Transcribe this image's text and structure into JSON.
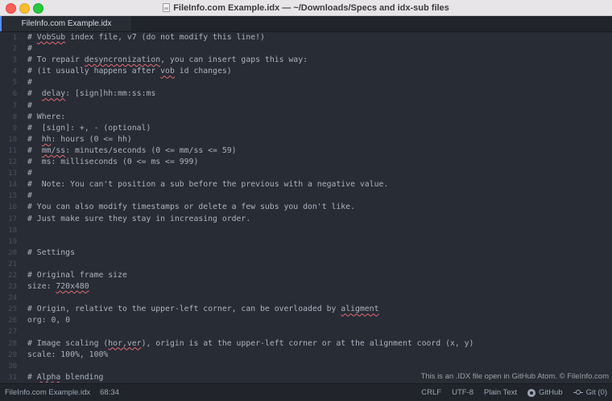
{
  "window": {
    "title": "FileInfo.com Example.idx — ~/Downloads/Specs and idx-sub files"
  },
  "tabs": [
    {
      "label": "FileInfo.com Example.idx",
      "active": true
    }
  ],
  "editor": {
    "lines": [
      {
        "n": "1",
        "text": "# VobSub index file, v7 (do not modify this line!)",
        "squiggles": [
          "VobSub"
        ]
      },
      {
        "n": "2",
        "text": "#"
      },
      {
        "n": "3",
        "text": "# To repair desyncronization, you can insert gaps this way:",
        "squiggles": [
          "desyncronization"
        ]
      },
      {
        "n": "4",
        "text": "# (it usually happens after vob id changes)",
        "squiggles": [
          "vob"
        ]
      },
      {
        "n": "5",
        "text": "#"
      },
      {
        "n": "6",
        "text": "#  delay: [sign]hh:mm:ss:ms",
        "squiggles": [
          "delay"
        ]
      },
      {
        "n": "7",
        "text": "#"
      },
      {
        "n": "8",
        "text": "# Where:"
      },
      {
        "n": "9",
        "text": "#  [sign]: +, - (optional)"
      },
      {
        "n": "10",
        "text": "#  hh: hours (0 <= hh)",
        "squiggles": [
          "hh"
        ]
      },
      {
        "n": "11",
        "text": "#  mm/ss: minutes/seconds (0 <= mm/ss <= 59)",
        "squiggles": [
          "mm/ss"
        ]
      },
      {
        "n": "12",
        "text": "#  ms: milliseconds (0 <= ms <= 999)"
      },
      {
        "n": "13",
        "text": "#"
      },
      {
        "n": "14",
        "text": "#  Note: You can't position a sub before the previous with a negative value."
      },
      {
        "n": "15",
        "text": "#"
      },
      {
        "n": "16",
        "text": "# You can also modify timestamps or delete a few subs you don't like."
      },
      {
        "n": "17",
        "text": "# Just make sure they stay in increasing order."
      },
      {
        "n": "18",
        "text": ""
      },
      {
        "n": "19",
        "text": ""
      },
      {
        "n": "20",
        "text": "# Settings"
      },
      {
        "n": "21",
        "text": ""
      },
      {
        "n": "22",
        "text": "# Original frame size"
      },
      {
        "n": "23",
        "text": "size: 720x480",
        "squiggles": [
          "720x480"
        ]
      },
      {
        "n": "24",
        "text": ""
      },
      {
        "n": "25",
        "text": "# Origin, relative to the upper-left corner, can be overloaded by aligment",
        "squiggles": [
          "aligment"
        ]
      },
      {
        "n": "26",
        "text": "org: 0, 0"
      },
      {
        "n": "27",
        "text": ""
      },
      {
        "n": "28",
        "text": "# Image scaling (hor,ver), origin is at the upper-left corner or at the alignment coord (x, y)",
        "squiggles": [
          "hor,ver"
        ]
      },
      {
        "n": "29",
        "text": "scale: 100%, 100%"
      },
      {
        "n": "30",
        "text": ""
      },
      {
        "n": "31",
        "text": "# Alpha blending",
        "squiggles": [
          "Alpha"
        ]
      }
    ]
  },
  "watermark": "This is an .IDX file open in GitHub Atom. © FileInfo.com",
  "statusbar": {
    "file": "FileInfo.com Example.idx",
    "cursor": "68:34",
    "line_ending": "CRLF",
    "encoding": "UTF-8",
    "grammar": "Plain Text",
    "github": "GitHub",
    "git": "Git (0)"
  },
  "colors": {
    "editor_bg": "#282c34",
    "text": "#abb2bf",
    "line_number": "#495162",
    "squiggle": "#e06c75",
    "tab_accent": "#528bff"
  }
}
